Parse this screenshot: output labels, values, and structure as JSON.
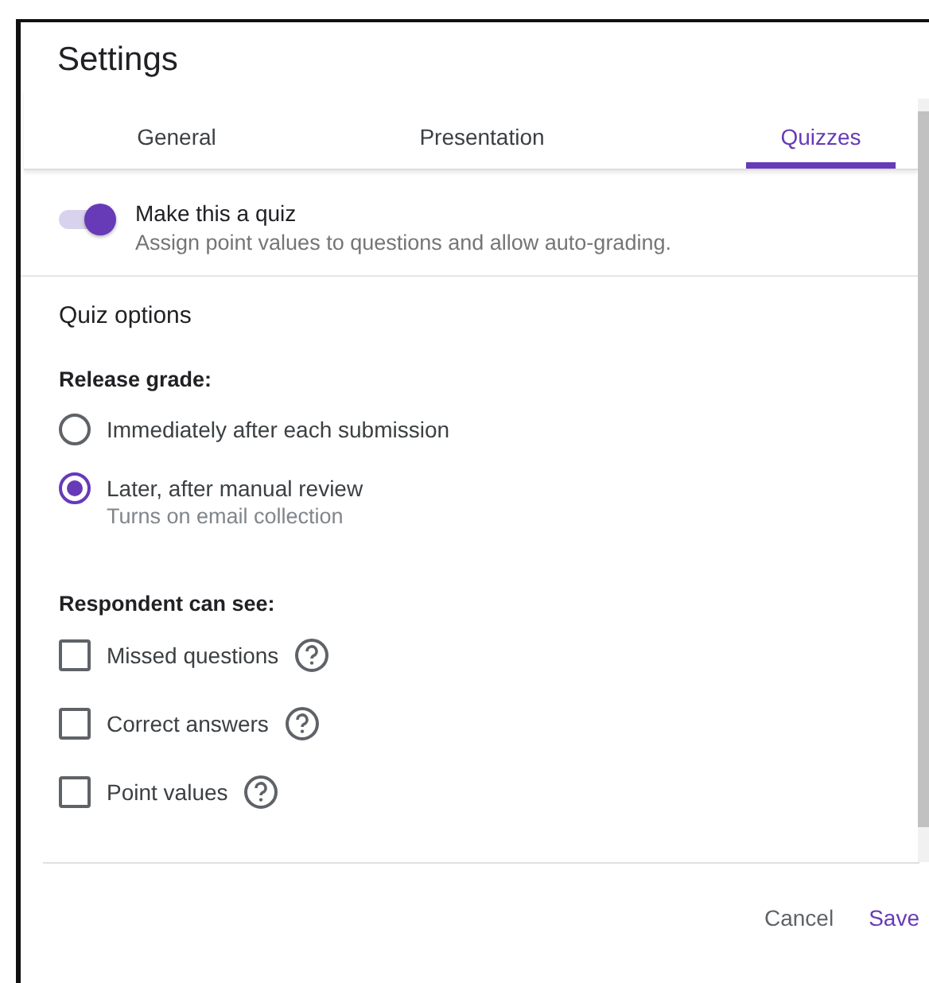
{
  "dialog": {
    "title": "Settings"
  },
  "tabs": [
    {
      "label": "General",
      "selected": false
    },
    {
      "label": "Presentation",
      "selected": false
    },
    {
      "label": "Quizzes",
      "selected": true
    }
  ],
  "quiz_toggle": {
    "label": "Make this a quiz",
    "description": "Assign point values to questions and allow auto-grading.",
    "on": true
  },
  "section_title": "Quiz options",
  "release_grade": {
    "heading": "Release grade:",
    "options": [
      {
        "label": "Immediately after each submission",
        "selected": false
      },
      {
        "label": "Later, after manual review",
        "hint": "Turns on email collection",
        "selected": true
      }
    ]
  },
  "respondent_can_see": {
    "heading": "Respondent can see:",
    "options": [
      {
        "label": "Missed questions",
        "checked": false
      },
      {
        "label": "Correct answers",
        "checked": false
      },
      {
        "label": "Point values",
        "checked": false
      }
    ]
  },
  "buttons": [
    {
      "label": "Cancel",
      "kind": "secondary"
    },
    {
      "label": "Save",
      "kind": "primary"
    }
  ]
}
